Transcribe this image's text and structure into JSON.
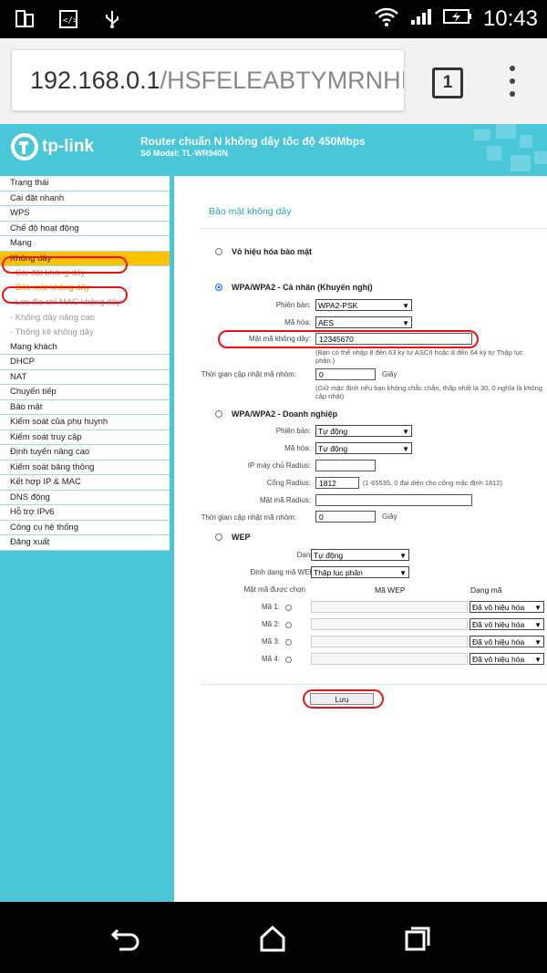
{
  "status_bar": {
    "time": "10:43"
  },
  "browser": {
    "url_host": "192.168.0.1",
    "url_path": "/HSFELEABTYMRNHI",
    "tab_count": "1"
  },
  "router": {
    "brand": "tp-link",
    "title": "Router chuẩn N không dây tốc độ 450Mbps",
    "model": "Số Model: TL-WR940N"
  },
  "sidebar": {
    "items": [
      "Trạng thái",
      "Cài đặt nhanh",
      "WPS",
      "Chế độ hoạt động",
      "Mạng",
      "Không dây"
    ],
    "sub_items": [
      "- Cài đặt không dây",
      "- Bảo mật không dây",
      "- Lọc địa chỉ MAC không dây",
      "- Không dây nâng cao",
      "- Thống kê không dây"
    ],
    "items_after": [
      "Mạng khách",
      "DHCP",
      "NAT",
      "Chuyển tiếp",
      "Bảo mật",
      "Kiểm soát của phụ huynh",
      "Kiểm soát truy cập",
      "Định tuyến nâng cao",
      "Kiểm soát băng thông",
      "Kết hợp IP & MAC",
      "DNS động",
      "Hỗ trợ IPv6",
      "Công cụ hệ thống",
      "Đăng xuất"
    ]
  },
  "main": {
    "section_title": "Bảo mật không dây",
    "disable": {
      "label": "Vô hiệu hóa bảo mật"
    },
    "personal": {
      "label": "WPA/WPA2 - Cá nhân (Khuyến nghị)",
      "version_label": "Phiên bản:",
      "version_value": "WPA2-PSK",
      "encryption_label": "Mã hóa:",
      "encryption_value": "AES",
      "password_label": "Mật mã không dây:",
      "password_value": "12345670",
      "password_note": "(Bạn có thể nhập 8 đến 63 ký tự ASCII hoặc 8 đến 64 ký tự Thập lục phân.)",
      "group_key_label": "Thời gian cập nhật mã nhóm:",
      "group_key_value": "0",
      "unit": "Giây",
      "group_key_note": "(Giữ mặc định nếu bạn không chắc chắn, thấp nhất là 30, 0 nghĩa là không cập nhật)"
    },
    "enterprise": {
      "label": "WPA/WPA2 - Doanh nghiệp",
      "version_label": "Phiên bản:",
      "version_value": "Tự động",
      "encryption_label": "Mã hóa:",
      "encryption_value": "Tự động",
      "radius_ip_label": "IP máy chủ Radius:",
      "radius_port_label": "Cổng Radius:",
      "radius_port_value": "1812",
      "radius_port_note": "(1-65535, 0 đại diện cho cổng mặc định 1812)",
      "radius_pass_label": "Mật mã Radius:",
      "group_key_label": "Thời gian cập nhật mã nhóm:",
      "group_key_value": "0",
      "unit": "Giây"
    },
    "wep": {
      "label": "WEP",
      "type_label": "Dạng:",
      "type_value": "Tự động",
      "format_label": "Định dạng mã WEP:",
      "format_value": "Thập lục phân",
      "selected_key_label": "Mật mã được chọn",
      "col_wep_key": "Mã WEP",
      "col_type": "Dạng mã",
      "keys": [
        {
          "label": "Mã 1:",
          "type": "Đã vô hiệu hóa"
        },
        {
          "label": "Mã 2:",
          "type": "Đã vô hiệu hóa"
        },
        {
          "label": "Mã 3:",
          "type": "Đã vô hiệu hóa"
        },
        {
          "label": "Mã 4:",
          "type": "Đã vô hiệu hóa"
        }
      ]
    },
    "save_label": "Lưu"
  },
  "colors": {
    "header": "#49c6d8",
    "highlight": "#ffc000",
    "annotation": "#e11111"
  }
}
